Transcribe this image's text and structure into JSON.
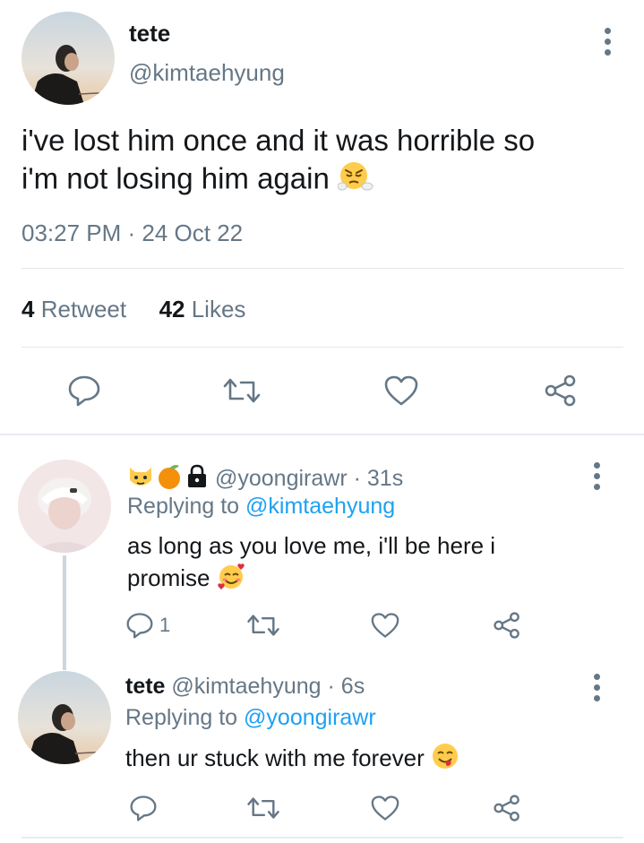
{
  "main_tweet": {
    "author_name": "tete",
    "author_handle": "@kimtaehyung",
    "text_line1": "i've lost him once and it was horrible so",
    "text_line2": "i'm not losing him again",
    "emoji": "steam-from-nose-face",
    "timestamp": "03:27 PM · 24 Oct 22",
    "retweet_count": "4",
    "retweet_label": "Retweet",
    "likes_count": "42",
    "likes_label": "Likes"
  },
  "replies": [
    {
      "name_emojis": [
        "cat-face",
        "tangerine",
        "lock"
      ],
      "author_name": "",
      "author_handle": "@yoongirawr",
      "time": "· 31s",
      "replying_prefix": "Replying to",
      "replying_to": "@kimtaehyung",
      "text_line1": "as long as you love me, i'll be here i",
      "text_line2": "promise",
      "emoji": "smiling-face-with-hearts",
      "reply_count": "1"
    },
    {
      "author_name": "tete",
      "author_handle": "@kimtaehyung",
      "time": "· 6s",
      "replying_prefix": "Replying to",
      "replying_to": "@yoongirawr",
      "text_line1": "then ur stuck with me forever",
      "emoji": "face-savoring-food"
    }
  ],
  "colors": {
    "text_primary": "#14171a",
    "text_secondary": "#657786",
    "link": "#1da1f2",
    "divider": "#e1e8ed"
  }
}
